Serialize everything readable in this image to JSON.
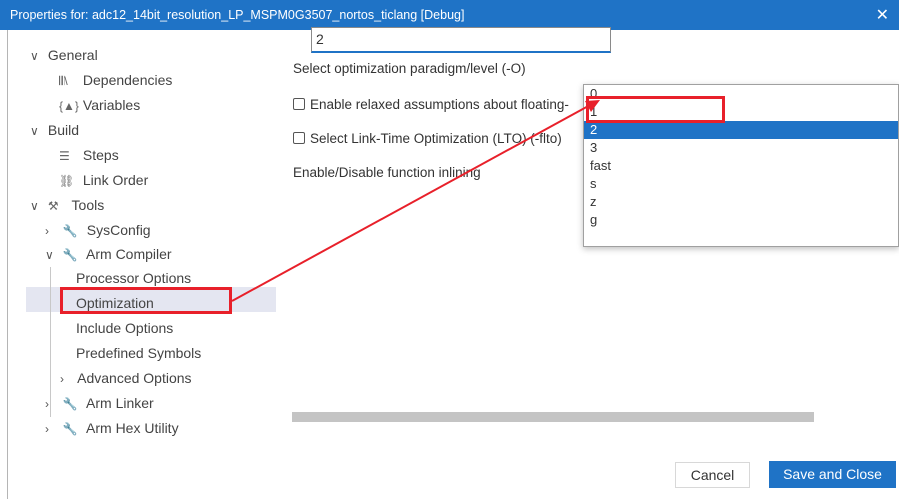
{
  "window": {
    "title": "Properties for: adc12_14bit_resolution_LP_MSPM0G3507_nortos_ticlang [Debug]",
    "close_glyph": "✕"
  },
  "sidebar": {
    "general": {
      "chevron": "∨",
      "label": "General"
    },
    "dependencies": {
      "icon": "𝄃𝄃\\",
      "label": "Dependencies"
    },
    "variables": {
      "icon": "{▲}",
      "label": "Variables"
    },
    "build": {
      "chevron": "∨",
      "label": "Build"
    },
    "steps": {
      "icon": "☰",
      "label": "Steps"
    },
    "link_order": {
      "icon": "⛓",
      "label": "Link Order"
    },
    "tools": {
      "chevron": "∨",
      "icon": "⚒",
      "label": "Tools"
    },
    "sysconfig": {
      "chevron": "›",
      "icon": "🔧",
      "label": "SysConfig"
    },
    "arm_compiler": {
      "chevron": "∨",
      "icon": "🔧",
      "label": "Arm Compiler"
    },
    "processor_options": "Processor Options",
    "optimization": "Optimization",
    "include_options": "Include Options",
    "predefined_symbols": "Predefined Symbols",
    "advanced_options": {
      "chevron": "›",
      "label": "Advanced Options"
    },
    "arm_linker": {
      "chevron": "›",
      "icon": "🔧",
      "label": "Arm Linker"
    },
    "arm_hex_utility": {
      "chevron": "›",
      "icon": "🔧",
      "label": "Arm Hex Utility"
    }
  },
  "main": {
    "optimization_label": "Select optimization paradigm/level (-O)",
    "optimization_value": "2",
    "relaxed_label": "Enable relaxed assumptions about floating-",
    "relaxed_checked": false,
    "lto_label": "Select Link-Time Optimization (LTO) (-flto)",
    "lto_checked": false,
    "inlining_label": "Enable/Disable function inlining"
  },
  "dropdown": {
    "options": [
      "0",
      "1",
      "2",
      "3",
      "fast",
      "s",
      "z",
      "g"
    ],
    "selected_index": 2
  },
  "buttons": {
    "cancel": "Cancel",
    "save": "Save and Close"
  },
  "colors": {
    "accent": "#1f73c6",
    "annotation": "#e8202a",
    "selection_bg": "#e4e6f1"
  }
}
